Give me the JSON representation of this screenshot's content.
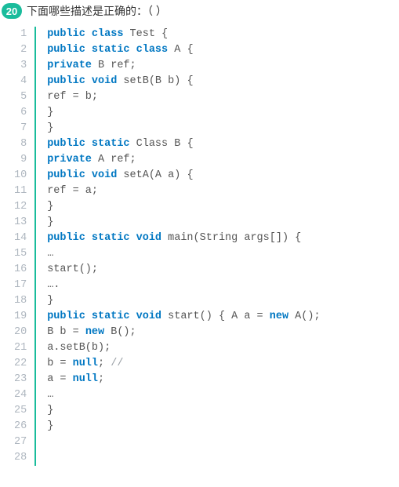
{
  "question": {
    "number": "20",
    "text": "下面哪些描述是正确的：（ ）"
  },
  "code": {
    "lines": [
      [
        {
          "t": "public class",
          "c": "kw"
        },
        {
          "t": " Test {",
          "c": ""
        }
      ],
      [
        {
          "t": "public static class",
          "c": "kw"
        },
        {
          "t": " A {",
          "c": ""
        }
      ],
      [
        {
          "t": "private",
          "c": "kw"
        },
        {
          "t": " B ref;",
          "c": ""
        }
      ],
      [
        {
          "t": "public void",
          "c": "kw"
        },
        {
          "t": " setB(B b) {",
          "c": ""
        }
      ],
      [
        {
          "t": "ref = b;",
          "c": ""
        }
      ],
      [
        {
          "t": "}",
          "c": ""
        }
      ],
      [
        {
          "t": "}",
          "c": ""
        }
      ],
      [
        {
          "t": "public static",
          "c": "kw"
        },
        {
          "t": " Class B {",
          "c": ""
        }
      ],
      [
        {
          "t": "private",
          "c": "kw"
        },
        {
          "t": " A ref;",
          "c": ""
        }
      ],
      [
        {
          "t": "public void",
          "c": "kw"
        },
        {
          "t": " setA(A a) {",
          "c": ""
        }
      ],
      [
        {
          "t": "ref = a;",
          "c": ""
        }
      ],
      [
        {
          "t": "}",
          "c": ""
        }
      ],
      [
        {
          "t": "}",
          "c": ""
        }
      ],
      [
        {
          "t": "public static void",
          "c": "kw"
        },
        {
          "t": " main(String args[]) {",
          "c": ""
        }
      ],
      [
        {
          "t": "…",
          "c": ""
        }
      ],
      [
        {
          "t": "start();",
          "c": ""
        }
      ],
      [
        {
          "t": "….",
          "c": ""
        }
      ],
      [
        {
          "t": "}",
          "c": ""
        }
      ],
      [
        {
          "t": "public static void",
          "c": "kw"
        },
        {
          "t": " start() { A a = ",
          "c": ""
        },
        {
          "t": "new",
          "c": "kw"
        },
        {
          "t": " A();",
          "c": ""
        }
      ],
      [
        {
          "t": "B b = ",
          "c": ""
        },
        {
          "t": "new",
          "c": "kw"
        },
        {
          "t": " B();",
          "c": ""
        }
      ],
      [
        {
          "t": "a.setB(b);",
          "c": ""
        }
      ],
      [
        {
          "t": "b = ",
          "c": ""
        },
        {
          "t": "null",
          "c": "kw"
        },
        {
          "t": "; ",
          "c": ""
        },
        {
          "t": "//",
          "c": "cmt"
        }
      ],
      [
        {
          "t": "a = ",
          "c": ""
        },
        {
          "t": "null",
          "c": "kw"
        },
        {
          "t": ";",
          "c": ""
        }
      ],
      [
        {
          "t": "…",
          "c": ""
        }
      ],
      [
        {
          "t": "}",
          "c": ""
        }
      ],
      [
        {
          "t": "}",
          "c": ""
        }
      ],
      [
        {
          "t": "",
          "c": ""
        }
      ],
      [
        {
          "t": "",
          "c": ""
        }
      ]
    ]
  }
}
